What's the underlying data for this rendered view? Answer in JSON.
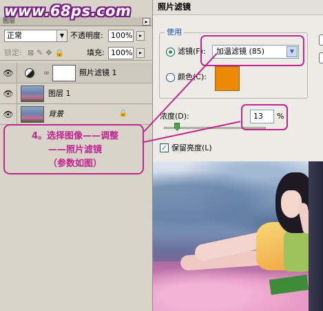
{
  "watermark": "www.68ps.com",
  "layers_panel": {
    "tab_label": "图层",
    "blend_mode": "正常",
    "opacity_label": "不透明度:",
    "opacity_value": "100%",
    "lock_label": "锁定:",
    "fill_label": "填充:",
    "fill_value": "100%",
    "layers": [
      {
        "name": "照片滤镜 1",
        "selected": true
      },
      {
        "name": "图层 1"
      },
      {
        "name": "背景",
        "locked": true
      }
    ]
  },
  "annotation": {
    "line1": "4。选择图像——调整",
    "line2": "——照片滤镜",
    "line3": "（参数如图）"
  },
  "dialog": {
    "title": "照片滤镜",
    "group_label": "使用",
    "filter_radio_label": "滤镜(F):",
    "filter_value": "加温滤镜 (85)",
    "color_radio_label": "颜色(C):",
    "color_value": "#ec8a06",
    "density_label": "浓度(D):",
    "density_value": "13",
    "density_unit": "%",
    "density_level": 13,
    "preserve_label": "保留亮度(L)",
    "preserve_checked": true
  },
  "colors": {
    "annotation_accent": "#c0258f",
    "panel_bg": "#d8d4c9",
    "dialog_bg": "#ecebe6"
  }
}
